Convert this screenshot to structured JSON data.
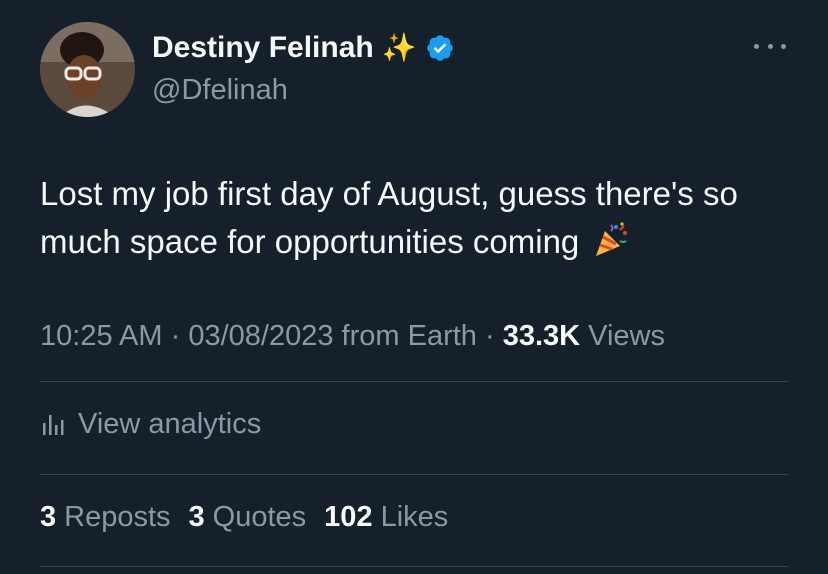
{
  "author": {
    "display_name": "Destiny Felinah",
    "handle": "@Dfelinah",
    "name_emoji": "✨",
    "verified": true
  },
  "tweet": {
    "text": "Lost my job first day of August, guess there's so much space for opportunities coming",
    "emoji": "party-popper"
  },
  "meta": {
    "time": "10:25 AM",
    "sep1": "·",
    "date": "03/08/2023",
    "source": "from Earth",
    "sep2": "·",
    "views_count": "33.3K",
    "views_label": "Views"
  },
  "analytics": {
    "label": "View analytics"
  },
  "stats": {
    "reposts_count": "3",
    "reposts_label": "Reposts",
    "quotes_count": "3",
    "quotes_label": "Quotes",
    "likes_count": "102",
    "likes_label": "Likes"
  },
  "colors": {
    "background": "#15202b",
    "primary_text": "#f7f9f9",
    "secondary_text": "#8b98a5",
    "verified_blue": "#1d9bf0",
    "divider": "#38444d"
  }
}
